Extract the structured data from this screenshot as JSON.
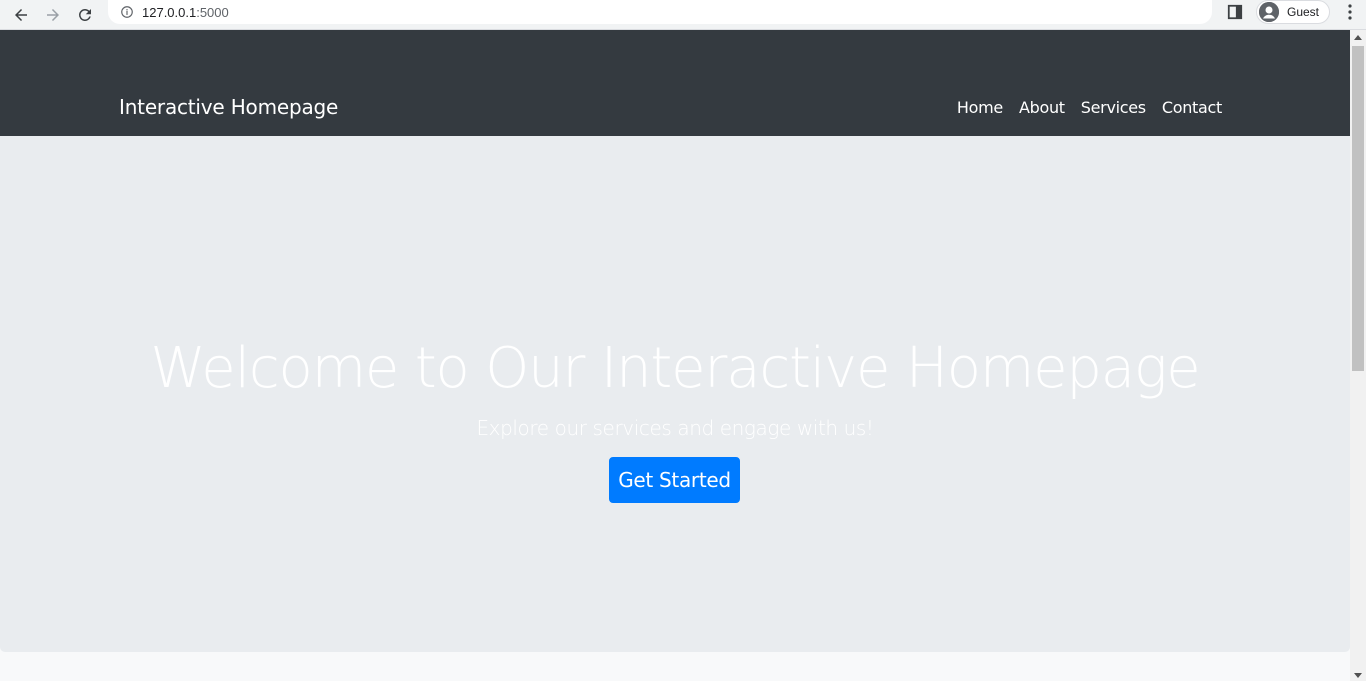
{
  "browser": {
    "url_host": "127.0.0.1",
    "url_port": ":5000",
    "profile_label": "Guest"
  },
  "navbar": {
    "brand": "Interactive Homepage",
    "links": [
      "Home",
      "About",
      "Services",
      "Contact"
    ]
  },
  "hero": {
    "title": "Welcome to Our Interactive Homepage",
    "subtitle": "Explore our services and engage with us!",
    "cta_label": "Get Started"
  },
  "colors": {
    "navbar_bg": "#343a40",
    "hero_bg": "#e9ecef",
    "primary": "#007bff"
  },
  "icons": [
    "back-arrow-icon",
    "forward-arrow-icon",
    "reload-icon",
    "info-icon",
    "side-panel-icon",
    "profile-avatar-icon",
    "kebab-menu-icon"
  ]
}
